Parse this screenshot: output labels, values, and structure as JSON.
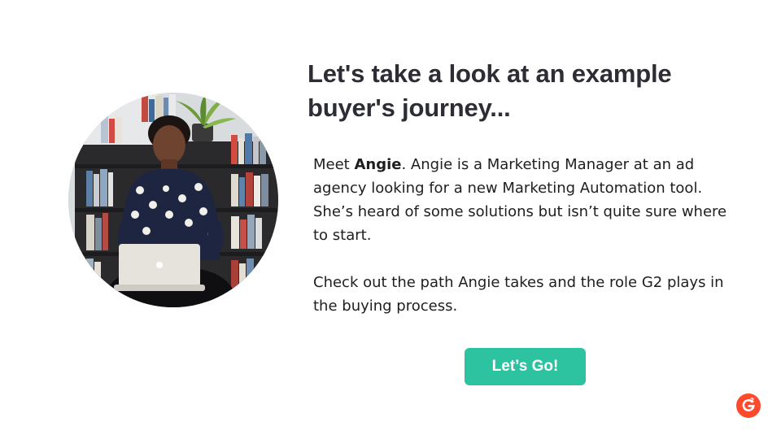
{
  "headline": {
    "line1": "Let's take a look at an example",
    "line2": "buyer's journey..."
  },
  "intro": {
    "meet": "Meet ",
    "name": "Angie",
    "line1_rest": ". Angie is a Marketing Manager at an ad",
    "line2": "agency looking for a new Marketing Automation tool.",
    "line3": "She’s heard of some solutions but isn’t quite sure where",
    "line4": "to start."
  },
  "outro": {
    "line1": "Check out the path Angie takes and the role G2 plays in",
    "line2": "the buying process."
  },
  "cta": {
    "label": "Let’s Go!",
    "color": "#2ec3a0"
  },
  "brand": {
    "logo_text": "G",
    "logo_color": "#ff492c"
  },
  "photo": {
    "icon": "person-with-laptop-photo"
  }
}
